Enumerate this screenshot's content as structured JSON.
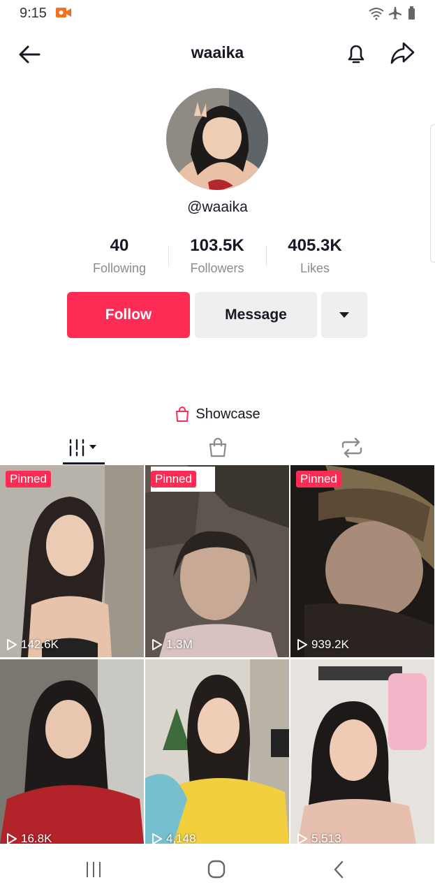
{
  "status": {
    "time": "9:15"
  },
  "header": {
    "title": "waaika"
  },
  "profile": {
    "handle": "@waaika"
  },
  "stats": [
    {
      "value": "40",
      "label": "Following"
    },
    {
      "value": "103.5K",
      "label": "Followers"
    },
    {
      "value": "405.3K",
      "label": "Likes"
    }
  ],
  "actions": {
    "follow": "Follow",
    "message": "Message"
  },
  "showcase": {
    "label": "Showcase"
  },
  "tabs": [
    "videos-icon",
    "shop-icon",
    "repost-icon"
  ],
  "videos": [
    {
      "pinned": "Pinned",
      "views": "142.6K"
    },
    {
      "pinned": "Pinned",
      "views": "1.3M"
    },
    {
      "pinned": "Pinned",
      "views": "939.2K"
    },
    {
      "pinned": "",
      "views": "16.8K"
    },
    {
      "pinned": "",
      "views": "4,148"
    },
    {
      "pinned": "",
      "views": "5,513"
    }
  ],
  "colors": {
    "accent": "#fe2c55",
    "secondary_button": "#efeff0",
    "text": "#161823",
    "muted": "#8a8b91"
  }
}
